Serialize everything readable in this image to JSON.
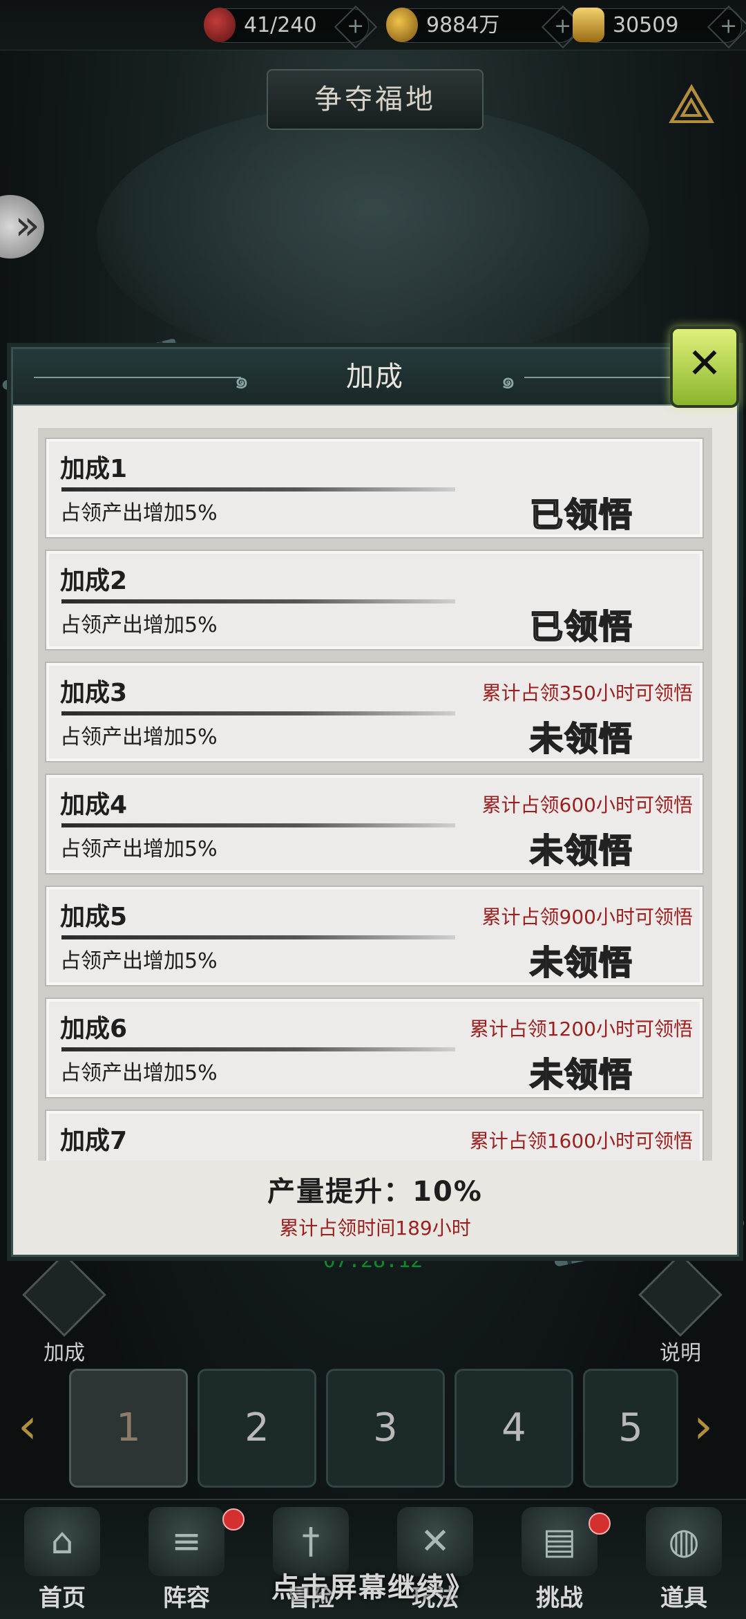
{
  "resources": [
    {
      "icon": "food-icon",
      "value": "41/240"
    },
    {
      "icon": "coin-icon",
      "value": "9884万"
    },
    {
      "icon": "gold-ingot-icon",
      "value": "30509"
    }
  ],
  "page_title": "争夺福地",
  "modal": {
    "title": "加成",
    "close_icon": "close-icon",
    "items": [
      {
        "name": "加成1",
        "desc": "占领产出增加5%",
        "requirement": "",
        "status": "已领悟"
      },
      {
        "name": "加成2",
        "desc": "占领产出增加5%",
        "requirement": "",
        "status": "已领悟"
      },
      {
        "name": "加成3",
        "desc": "占领产出增加5%",
        "requirement": "累计占领350小时可领悟",
        "status": "未领悟"
      },
      {
        "name": "加成4",
        "desc": "占领产出增加5%",
        "requirement": "累计占领600小时可领悟",
        "status": "未领悟"
      },
      {
        "name": "加成5",
        "desc": "占领产出增加5%",
        "requirement": "累计占领900小时可领悟",
        "status": "未领悟"
      },
      {
        "name": "加成6",
        "desc": "占领产出增加5%",
        "requirement": "累计占领1200小时可领悟",
        "status": "未领悟"
      },
      {
        "name": "加成7",
        "desc": "",
        "requirement": "累计占领1600小时可领悟",
        "status": ""
      }
    ],
    "summary": {
      "boost": "产量提升：10%",
      "time": "累计占领时间189小时"
    }
  },
  "side_buttons": {
    "left_label": "加成",
    "right_label": "说明"
  },
  "timer": "07:28:12",
  "slots": [
    "1",
    "2",
    "3",
    "4",
    "5"
  ],
  "bottom_nav": [
    {
      "label": "首页",
      "icon": "palace-icon"
    },
    {
      "label": "阵容",
      "icon": "scroll-icon"
    },
    {
      "label": "冒险",
      "icon": "sword-icon"
    },
    {
      "label": "玩法",
      "icon": "crossed-swords-icon"
    },
    {
      "label": "挑战",
      "icon": "challenge-icon"
    },
    {
      "label": "道具",
      "icon": "bag-icon"
    }
  ],
  "continue_hint": "点击屏幕继续》"
}
